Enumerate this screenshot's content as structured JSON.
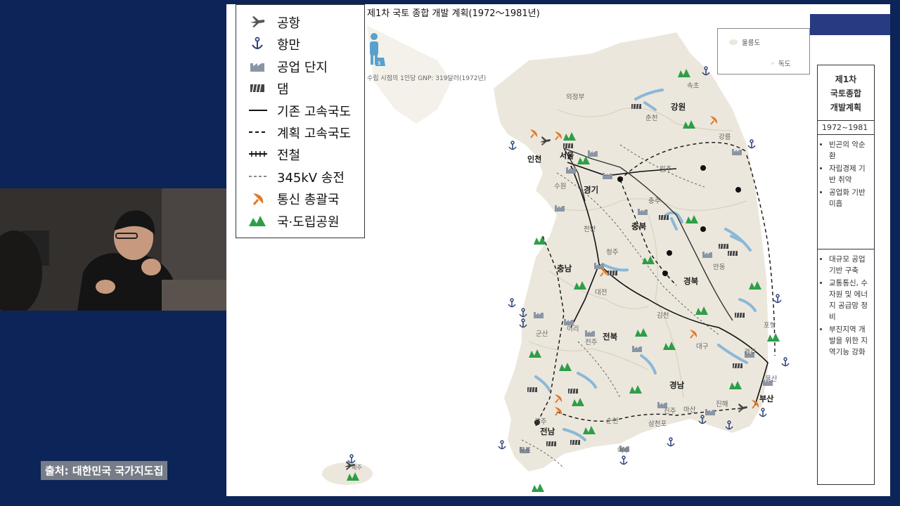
{
  "colors": {
    "background": "#0d2458",
    "land": "#ece7dc",
    "sea": "#ffffff",
    "park": "#2e9e48",
    "comm": "#e07a2c",
    "water": "#8ab8d8",
    "industry": "#8a96a6",
    "panel_band": "#283a82"
  },
  "map": {
    "title": "제1차 국토 종합 개발 계획(1972～1981년)",
    "gnp_note": "수립 시점의 1인당 GNP: 319달러(1972년)",
    "inset": {
      "island1": "울릉도",
      "island2": "독도"
    },
    "legend": [
      {
        "icon": "airplane-icon",
        "label": "공항"
      },
      {
        "icon": "anchor-icon",
        "label": "항만"
      },
      {
        "icon": "factory-icon",
        "label": "공업 단지"
      },
      {
        "icon": "dam-icon",
        "label": "댐"
      },
      {
        "icon": "solid-line-icon",
        "label": "기존 고속국도"
      },
      {
        "icon": "dashed-line-icon",
        "label": "계획 고속국도"
      },
      {
        "icon": "railway-icon",
        "label": "전철"
      },
      {
        "icon": "thin-dashed-line-icon",
        "label": "345kV 송전"
      },
      {
        "icon": "satellite-dish-icon",
        "label": "통신 총괄국"
      },
      {
        "icon": "park-mountain-icon",
        "label": "국·도립공원"
      }
    ],
    "provinces": [
      "강원",
      "경기",
      "충북",
      "충남",
      "경북",
      "전북",
      "경남",
      "전남"
    ],
    "cities": [
      "속초",
      "의정부",
      "춘천",
      "강릉",
      "서울",
      "인천",
      "원주",
      "수원",
      "충주",
      "천안",
      "청주",
      "안동",
      "대전",
      "포항",
      "김천",
      "군산",
      "이리",
      "전주",
      "대구",
      "경주",
      "울산",
      "진주",
      "마산",
      "진해",
      "부산",
      "광주",
      "순천",
      "삼천포",
      "목포",
      "여수",
      "제주"
    ]
  },
  "side_panel": {
    "title": "제1차\n국토종합\n개발계획",
    "period": "1972~1981",
    "background_items": [
      "빈곤의 악순환",
      "자립경제 기반 취약",
      "공업화 기반 미흡"
    ],
    "goal_items": [
      "대규모 공업기반 구축",
      "교통통신, 수자원 및 에너지 공급망 정비",
      "부진지역 개발을 위한 지역기능 강화"
    ]
  },
  "caption": "출처: 대한민국 국가지도집"
}
